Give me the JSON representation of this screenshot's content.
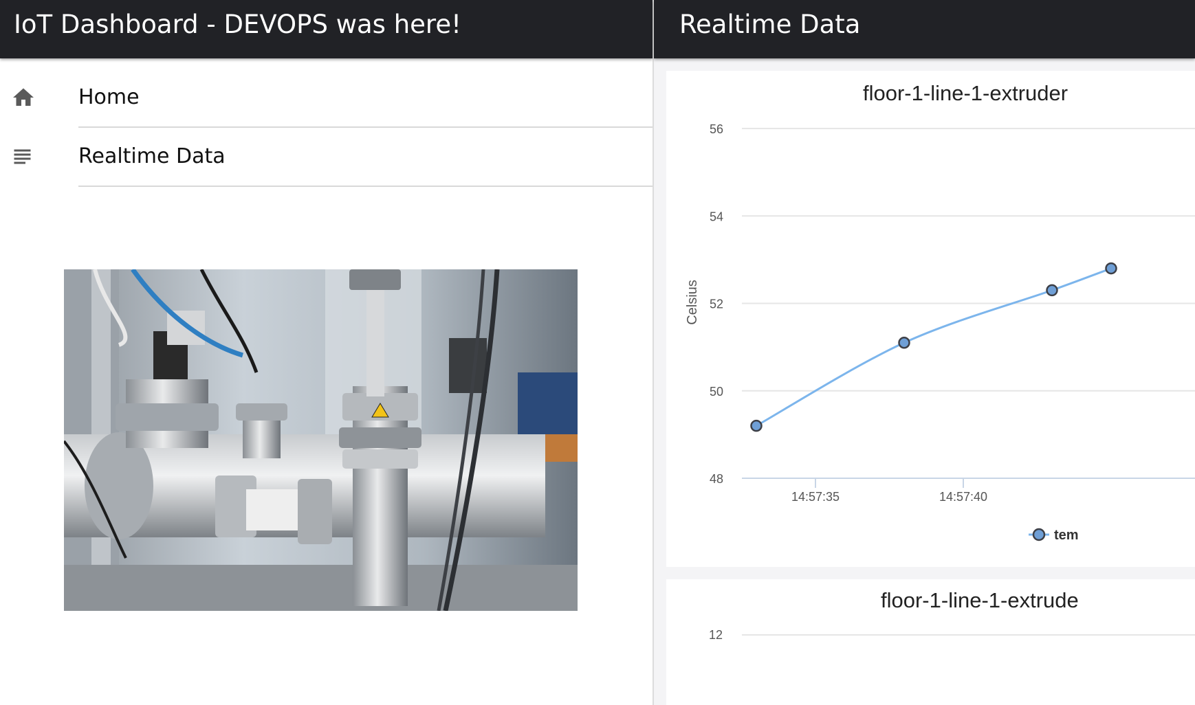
{
  "app": {
    "title": "IoT Dashboard - DEVOPS was here!"
  },
  "nav": {
    "items": [
      {
        "label": "Home",
        "icon": "home-icon"
      },
      {
        "label": "Realtime Data",
        "icon": "list-icon"
      }
    ]
  },
  "realtime": {
    "title": "Realtime Data"
  },
  "colors": {
    "topbar": "#212226",
    "series": "#7cb5ec",
    "marker_fill": "#6f9fd6",
    "marker_stroke": "#3d3f46"
  },
  "chart_data": [
    {
      "type": "line",
      "title": "floor-1-line-1-extruder",
      "ylabel": "Celsius",
      "ylim": [
        48,
        56
      ],
      "yticks": [
        "48",
        "50",
        "52",
        "54",
        "56"
      ],
      "xticks": [
        "14:57:35",
        "14:57:40"
      ],
      "grid": true,
      "legend": {
        "placement": "bottom",
        "label": "tem"
      },
      "series": [
        {
          "points": [
            {
              "x": "14:57:33",
              "y": 49.2
            },
            {
              "x": "14:57:38",
              "y": 51.1
            },
            {
              "x": "14:57:43",
              "y": 52.3
            },
            {
              "x": "14:57:45",
              "y": 52.8
            }
          ]
        }
      ]
    },
    {
      "type": "line",
      "title": "floor-1-line-1-extrude",
      "yticks": [
        "12"
      ]
    }
  ]
}
